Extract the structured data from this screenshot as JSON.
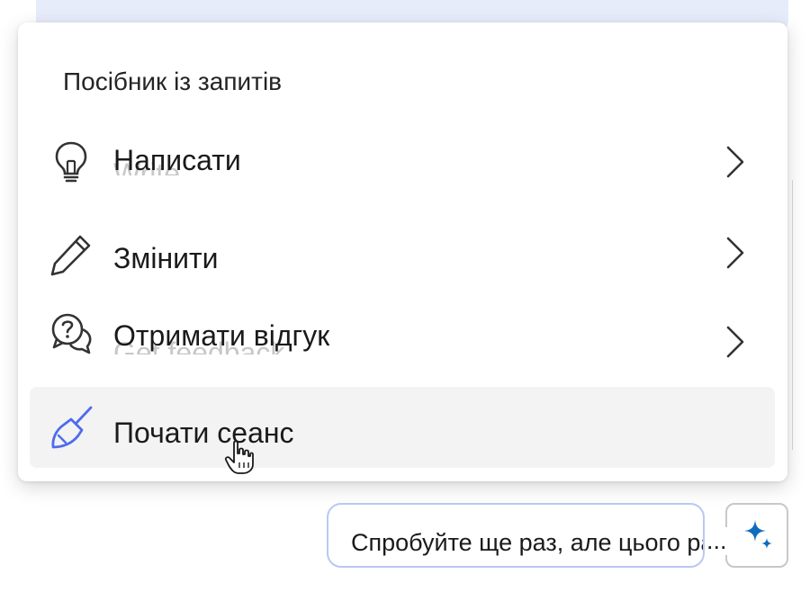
{
  "menu": {
    "title": "Посібник із запитів",
    "items": [
      {
        "label": "Написати",
        "ghost": "Write",
        "icon": "lightbulb-icon",
        "has_submenu": true
      },
      {
        "label": "Змінити",
        "ghost": "",
        "icon": "pencil-icon",
        "has_submenu": true
      },
      {
        "label": "Отримати відгук",
        "ghost": "Get feedback",
        "icon": "chat-question-icon",
        "has_submenu": true
      },
      {
        "label": "Почати сеанс",
        "ghost": "",
        "icon": "broom-icon",
        "has_submenu": false,
        "hovered": true
      }
    ]
  },
  "suggestion": {
    "text": "Спробуйте ще раз, але цього разу",
    "ellipsis": "..."
  },
  "colors": {
    "accent": "#0f6cbd",
    "broom": "#4f6bed",
    "pill_border": "#b9c8f4",
    "top_bar": "#e7ecfb",
    "hover": "#f3f3f3"
  }
}
